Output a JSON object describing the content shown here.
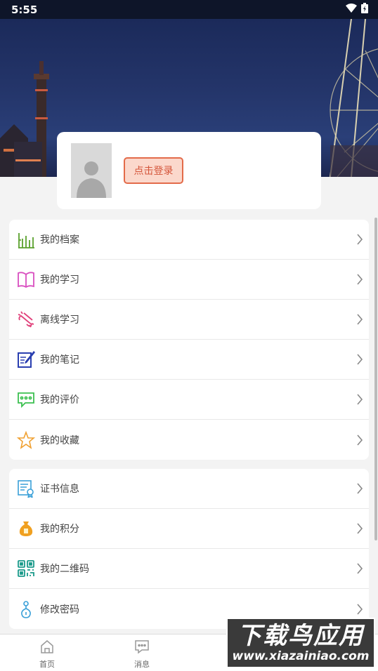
{
  "status_bar": {
    "time": "5:55"
  },
  "profile": {
    "login_label": "点击登录"
  },
  "menu_group_1": [
    {
      "label": "我的档案",
      "icon": "archive-chart-icon",
      "color": "#5aa02c"
    },
    {
      "label": "我的学习",
      "icon": "book-icon",
      "color": "#d94fc0"
    },
    {
      "label": "离线学习",
      "icon": "offline-icon",
      "color": "#e0407a"
    },
    {
      "label": "我的笔记",
      "icon": "note-edit-icon",
      "color": "#2a3fb0"
    },
    {
      "label": "我的评价",
      "icon": "comment-icon",
      "color": "#3cc050"
    },
    {
      "label": "我的收藏",
      "icon": "star-icon",
      "color": "#f0a030"
    }
  ],
  "menu_group_2": [
    {
      "label": "证书信息",
      "icon": "certificate-icon",
      "color": "#3aa0d8"
    },
    {
      "label": "我的积分",
      "icon": "points-bag-icon",
      "color": "#f0a020"
    },
    {
      "label": "我的二维码",
      "icon": "qrcode-icon",
      "color": "#1a9a8a"
    },
    {
      "label": "修改密码",
      "icon": "key-icon",
      "color": "#3aa0d8"
    }
  ],
  "bottom_nav": [
    {
      "label": "首页",
      "icon": "home-icon"
    },
    {
      "label": "消息",
      "icon": "message-icon"
    }
  ],
  "watermark": {
    "title": "下载鸟应用",
    "url": "www.xiazainiao.com"
  }
}
